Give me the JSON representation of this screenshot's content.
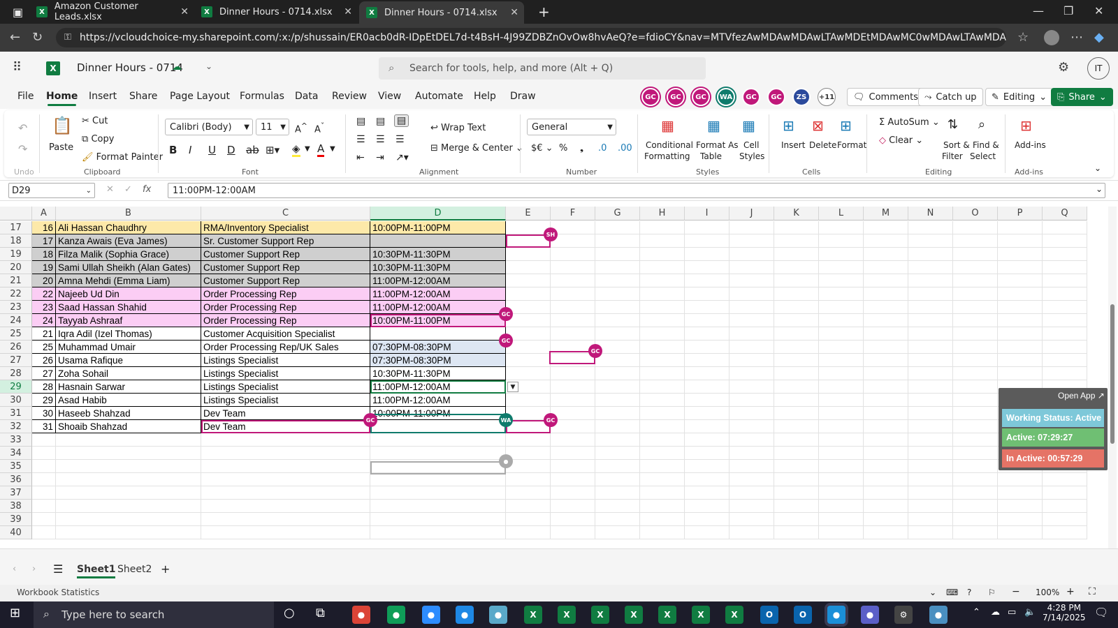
{
  "browser": {
    "tabs": [
      {
        "title": "Amazon Customer Leads.xlsx"
      },
      {
        "title": "Dinner Hours - 0714.xlsx"
      },
      {
        "title": "Dinner Hours - 0714.xlsx"
      }
    ],
    "url": "https://vcloudchoice-my.sharepoint.com/:x:/p/shussain/ER0acb0dR-IDpEtDEL7d-t4BsH-4J99ZDBZnOvOw8hvAeQ?e=fdioCY&nav=MTVfezAwMDAwMDAwLTAwMDEtMDAwMC0wMDAwLTAwMDAwMDAw..."
  },
  "app": {
    "title": "Dinner Hours - 0714",
    "search_placeholder": "Search for tools, help, and more (Alt + Q)",
    "user_initials": "IT"
  },
  "menu": [
    "File",
    "Home",
    "Insert",
    "Share",
    "Page Layout",
    "Formulas",
    "Data",
    "Review",
    "View",
    "Automate",
    "Help",
    "Draw"
  ],
  "collaborators": [
    {
      "initials": "GC",
      "color": "#c0187a"
    },
    {
      "initials": "GC",
      "color": "#c0187a"
    },
    {
      "initials": "GC",
      "color": "#c0187a"
    },
    {
      "initials": "WA",
      "color": "#0f7b6c"
    },
    {
      "initials": "GC",
      "color": "#c0187a"
    },
    {
      "initials": "GC",
      "color": "#c0187a"
    },
    {
      "initials": "ZS",
      "color": "#2b4a9c"
    },
    {
      "initials": "+11",
      "color": "#555555"
    }
  ],
  "header_buttons": {
    "comments": "Comments",
    "catchup": "Catch up",
    "editing": "Editing",
    "share": "Share"
  },
  "ribbon": {
    "undo": "Undo",
    "paste": "Paste",
    "cut": "Cut",
    "copy": "Copy",
    "format_painter": "Format Painter",
    "clipboard": "Clipboard",
    "font_name": "Calibri (Body)",
    "font_size": "11",
    "font": "Font",
    "wrap_text": "Wrap Text",
    "merge_center": "Merge & Center",
    "alignment": "Alignment",
    "number_format": "General",
    "number": "Number",
    "cond_fmt_1": "Conditional",
    "cond_fmt_2": "Formatting",
    "fmt_table_1": "Format As",
    "fmt_table_2": "Table",
    "cell_styles_1": "Cell",
    "cell_styles_2": "Styles",
    "styles": "Styles",
    "insert": "Insert",
    "delete": "Delete",
    "format": "Format",
    "cells": "Cells",
    "autosum": "AutoSum",
    "clear": "Clear",
    "sort_1": "Sort &",
    "sort_2": "Filter",
    "find_1": "Find &",
    "find_2": "Select",
    "editing": "Editing",
    "addins": "Add-ins",
    "addins_group": "Add-ins"
  },
  "formula_bar": {
    "name_box": "D29",
    "formula": "11:00PM-12:00AM"
  },
  "columns": [
    "A",
    "B",
    "C",
    "D",
    "E",
    "F",
    "G",
    "H",
    "I",
    "J",
    "K",
    "L",
    "M",
    "N",
    "O",
    "P",
    "Q"
  ],
  "rows": [
    {
      "num": "17",
      "a": "16",
      "b": "Ali Hassan Chaudhry",
      "c": "RMA/Inventory Specialist",
      "d": "10:00PM-11:00PM",
      "fill": "#fde9a9"
    },
    {
      "num": "18",
      "a": "17",
      "b": "Kanza Awais (Eva James)",
      "c": "Sr. Customer Support Rep",
      "d": "",
      "fill": "#cfcfcf"
    },
    {
      "num": "19",
      "a": "18",
      "b": "Filza Malik (Sophia Grace)",
      "c": "Customer Support Rep",
      "d": "10:30PM-11:30PM",
      "fill": "#cfcfcf"
    },
    {
      "num": "20",
      "a": "19",
      "b": "Sami Ullah Sheikh (Alan Gates)",
      "c": "Customer Support Rep",
      "d": "10:30PM-11:30PM",
      "fill": "#cfcfcf"
    },
    {
      "num": "21",
      "a": "20",
      "b": "Amna Mehdi (Emma Liam)",
      "c": "Customer Support Rep",
      "d": "11:00PM-12:00AM",
      "fill": "#cfcfcf"
    },
    {
      "num": "22",
      "a": "22",
      "b": "Najeeb Ud Din",
      "c": "Order Processing Rep",
      "d": "11:00PM-12:00AM",
      "fill": "#fbcdf4"
    },
    {
      "num": "23",
      "a": "23",
      "b": "Saad Hassan Shahid",
      "c": "Order Processing Rep",
      "d": "11:00PM-12:00AM",
      "fill": "#fbcdf4"
    },
    {
      "num": "24",
      "a": "24",
      "b": "Tayyab Ashraaf",
      "c": "Order Processing Rep",
      "d": "10:00PM-11:00PM",
      "fill": "#fbcdf4"
    },
    {
      "num": "25",
      "a": "21",
      "b": "Iqra Adil (Izel Thomas)",
      "c": "Customer Acquisition Specialist",
      "d": "",
      "fill": "#ffffff"
    },
    {
      "num": "26",
      "a": "25",
      "b": "Muhammad Umair",
      "c": "Order Processing Rep/UK Sales",
      "d": "07:30PM-08:30PM",
      "fill": "#ffffff",
      "dfill": "#dde6f3"
    },
    {
      "num": "27",
      "a": "26",
      "b": "Usama Rafique",
      "c": "Listings Specialist",
      "d": "07:30PM-08:30PM",
      "fill": "#ffffff",
      "dfill": "#dde6f3"
    },
    {
      "num": "28",
      "a": "27",
      "b": "Zoha Sohail",
      "c": "Listings Specialist",
      "d": "10:30PM-11:30PM",
      "fill": "#ffffff"
    },
    {
      "num": "29",
      "a": "28",
      "b": "Hasnain Sarwar",
      "c": "Listings Specialist",
      "d": "11:00PM-12:00AM",
      "fill": "#ffffff"
    },
    {
      "num": "30",
      "a": "29",
      "b": "Asad Habib",
      "c": "Listings Specialist",
      "d": "11:00PM-12:00AM",
      "fill": "#ffffff"
    },
    {
      "num": "31",
      "a": "30",
      "b": "Haseeb Shahzad",
      "c": "Dev Team",
      "d": "10:00PM-11:00PM",
      "fill": "#ffffff"
    },
    {
      "num": "32",
      "a": "31",
      "b": "Shoaib Shahzad",
      "c": "Dev Team",
      "d": "",
      "fill": "#ffffff"
    }
  ],
  "empty_rows": [
    "33",
    "34",
    "35",
    "36",
    "37",
    "38",
    "39",
    "40"
  ],
  "presence_badges": [
    "SH",
    "GC",
    "GC",
    "GC",
    "GC",
    "WA",
    "GC"
  ],
  "working_panel": {
    "open_app": "Open App ↗",
    "status": "Working Status: Active",
    "active": "Active: 07:29:27",
    "inactive": "In Active: 00:57:29",
    "status_color": "#7ec8d9",
    "active_color": "#6fbf73",
    "inactive_color": "#e57366"
  },
  "sheets": [
    "Sheet1",
    "Sheet2"
  ],
  "statusbar": {
    "left": "Workbook Statistics",
    "zoom": "100%"
  },
  "taskbar": {
    "search_placeholder": "Type here to search",
    "time": "4:28 PM",
    "date": "7/14/2025"
  }
}
